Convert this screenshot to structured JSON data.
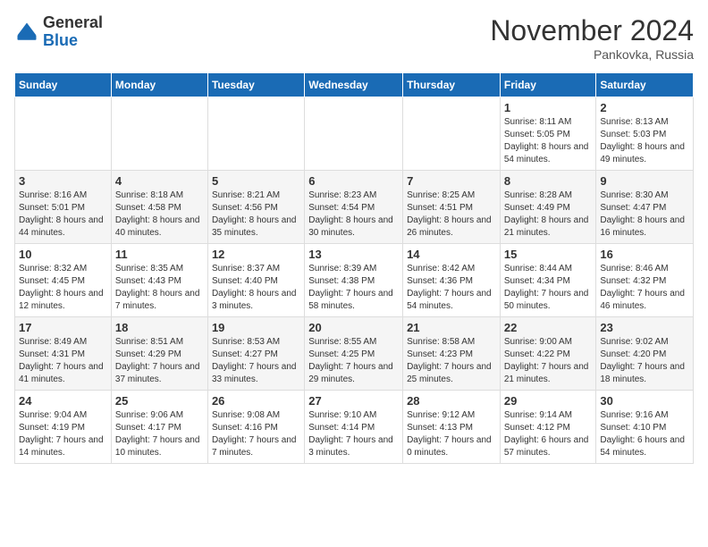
{
  "header": {
    "logo_general": "General",
    "logo_blue": "Blue",
    "month_title": "November 2024",
    "location": "Pankovka, Russia"
  },
  "weekdays": [
    "Sunday",
    "Monday",
    "Tuesday",
    "Wednesday",
    "Thursday",
    "Friday",
    "Saturday"
  ],
  "weeks": [
    [
      {
        "day": "",
        "detail": ""
      },
      {
        "day": "",
        "detail": ""
      },
      {
        "day": "",
        "detail": ""
      },
      {
        "day": "",
        "detail": ""
      },
      {
        "day": "",
        "detail": ""
      },
      {
        "day": "1",
        "detail": "Sunrise: 8:11 AM\nSunset: 5:05 PM\nDaylight: 8 hours\nand 54 minutes."
      },
      {
        "day": "2",
        "detail": "Sunrise: 8:13 AM\nSunset: 5:03 PM\nDaylight: 8 hours\nand 49 minutes."
      }
    ],
    [
      {
        "day": "3",
        "detail": "Sunrise: 8:16 AM\nSunset: 5:01 PM\nDaylight: 8 hours\nand 44 minutes."
      },
      {
        "day": "4",
        "detail": "Sunrise: 8:18 AM\nSunset: 4:58 PM\nDaylight: 8 hours\nand 40 minutes."
      },
      {
        "day": "5",
        "detail": "Sunrise: 8:21 AM\nSunset: 4:56 PM\nDaylight: 8 hours\nand 35 minutes."
      },
      {
        "day": "6",
        "detail": "Sunrise: 8:23 AM\nSunset: 4:54 PM\nDaylight: 8 hours\nand 30 minutes."
      },
      {
        "day": "7",
        "detail": "Sunrise: 8:25 AM\nSunset: 4:51 PM\nDaylight: 8 hours\nand 26 minutes."
      },
      {
        "day": "8",
        "detail": "Sunrise: 8:28 AM\nSunset: 4:49 PM\nDaylight: 8 hours\nand 21 minutes."
      },
      {
        "day": "9",
        "detail": "Sunrise: 8:30 AM\nSunset: 4:47 PM\nDaylight: 8 hours\nand 16 minutes."
      }
    ],
    [
      {
        "day": "10",
        "detail": "Sunrise: 8:32 AM\nSunset: 4:45 PM\nDaylight: 8 hours\nand 12 minutes."
      },
      {
        "day": "11",
        "detail": "Sunrise: 8:35 AM\nSunset: 4:43 PM\nDaylight: 8 hours\nand 7 minutes."
      },
      {
        "day": "12",
        "detail": "Sunrise: 8:37 AM\nSunset: 4:40 PM\nDaylight: 8 hours\nand 3 minutes."
      },
      {
        "day": "13",
        "detail": "Sunrise: 8:39 AM\nSunset: 4:38 PM\nDaylight: 7 hours\nand 58 minutes."
      },
      {
        "day": "14",
        "detail": "Sunrise: 8:42 AM\nSunset: 4:36 PM\nDaylight: 7 hours\nand 54 minutes."
      },
      {
        "day": "15",
        "detail": "Sunrise: 8:44 AM\nSunset: 4:34 PM\nDaylight: 7 hours\nand 50 minutes."
      },
      {
        "day": "16",
        "detail": "Sunrise: 8:46 AM\nSunset: 4:32 PM\nDaylight: 7 hours\nand 46 minutes."
      }
    ],
    [
      {
        "day": "17",
        "detail": "Sunrise: 8:49 AM\nSunset: 4:31 PM\nDaylight: 7 hours\nand 41 minutes."
      },
      {
        "day": "18",
        "detail": "Sunrise: 8:51 AM\nSunset: 4:29 PM\nDaylight: 7 hours\nand 37 minutes."
      },
      {
        "day": "19",
        "detail": "Sunrise: 8:53 AM\nSunset: 4:27 PM\nDaylight: 7 hours\nand 33 minutes."
      },
      {
        "day": "20",
        "detail": "Sunrise: 8:55 AM\nSunset: 4:25 PM\nDaylight: 7 hours\nand 29 minutes."
      },
      {
        "day": "21",
        "detail": "Sunrise: 8:58 AM\nSunset: 4:23 PM\nDaylight: 7 hours\nand 25 minutes."
      },
      {
        "day": "22",
        "detail": "Sunrise: 9:00 AM\nSunset: 4:22 PM\nDaylight: 7 hours\nand 21 minutes."
      },
      {
        "day": "23",
        "detail": "Sunrise: 9:02 AM\nSunset: 4:20 PM\nDaylight: 7 hours\nand 18 minutes."
      }
    ],
    [
      {
        "day": "24",
        "detail": "Sunrise: 9:04 AM\nSunset: 4:19 PM\nDaylight: 7 hours\nand 14 minutes."
      },
      {
        "day": "25",
        "detail": "Sunrise: 9:06 AM\nSunset: 4:17 PM\nDaylight: 7 hours\nand 10 minutes."
      },
      {
        "day": "26",
        "detail": "Sunrise: 9:08 AM\nSunset: 4:16 PM\nDaylight: 7 hours\nand 7 minutes."
      },
      {
        "day": "27",
        "detail": "Sunrise: 9:10 AM\nSunset: 4:14 PM\nDaylight: 7 hours\nand 3 minutes."
      },
      {
        "day": "28",
        "detail": "Sunrise: 9:12 AM\nSunset: 4:13 PM\nDaylight: 7 hours\nand 0 minutes."
      },
      {
        "day": "29",
        "detail": "Sunrise: 9:14 AM\nSunset: 4:12 PM\nDaylight: 6 hours\nand 57 minutes."
      },
      {
        "day": "30",
        "detail": "Sunrise: 9:16 AM\nSunset: 4:10 PM\nDaylight: 6 hours\nand 54 minutes."
      }
    ]
  ]
}
